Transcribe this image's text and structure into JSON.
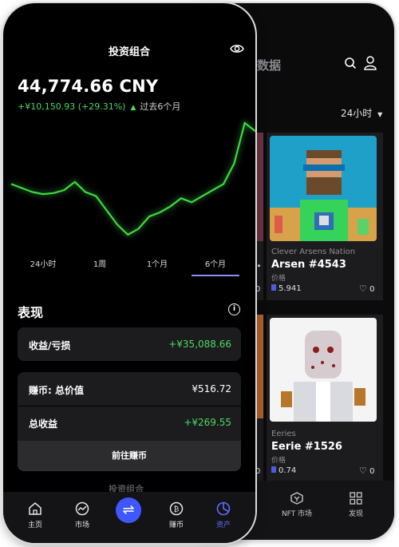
{
  "front": {
    "title": "投资组合",
    "balance": "44,774.66 CNY",
    "change_value": "+¥10,150.93 (+29.31%)",
    "change_period": "过去6个月",
    "chart_series": [
      46,
      44,
      42,
      41,
      41.5,
      43,
      47,
      42,
      40,
      33,
      26,
      21,
      24,
      30,
      32,
      35,
      39,
      37,
      40,
      43,
      46,
      56,
      76,
      72
    ],
    "ranges": [
      "24小时",
      "1周",
      "1个月",
      "6个月"
    ],
    "active_range": "6个月",
    "performance": {
      "title": "表现",
      "pnl_label": "收益/亏损",
      "pnl_value": "+¥35,088.66",
      "earn_total_label": "赚币: 总价值",
      "earn_total_value": "¥516.72",
      "total_income_label": "总收益",
      "total_income_value": "+¥269.55",
      "go_earn_button": "前往赚币"
    },
    "peek_text": "投资组合",
    "tabs": [
      {
        "label": "主页",
        "icon": "home-icon"
      },
      {
        "label": "市场",
        "icon": "market-chart-icon"
      },
      {
        "label": "",
        "icon": "swap-icon"
      },
      {
        "label": "赚币",
        "icon": "coin-icon"
      },
      {
        "label": "资产",
        "icon": "assets-pie-icon"
      }
    ],
    "active_tab": "资产",
    "accent_color": "#5c6cff",
    "positive_color": "#4cd964"
  },
  "back": {
    "title_fragment": "数据",
    "range": "24小时",
    "nfts": [
      {
        "collection": "Clever Arsens Nation",
        "name": "Arsen #4543",
        "price_label": "价格",
        "price": "5.941",
        "likes": "0"
      },
      {
        "collection": "Eeries",
        "name": "Eerie #1526",
        "price_label": "价格",
        "price": "0.74",
        "likes": "0"
      }
    ],
    "left_card_likes": [
      "0",
      "0"
    ],
    "left_card_name_fragment": ".",
    "tabs": [
      {
        "label": "NFT 市场",
        "icon": "nft-market-icon"
      },
      {
        "label": "发现",
        "icon": "discover-grid-icon"
      }
    ]
  }
}
